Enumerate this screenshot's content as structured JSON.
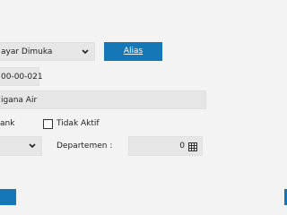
{
  "form": {
    "account_type": {
      "value": "ayar Dimuka"
    },
    "alias_button": {
      "label": "Alias"
    },
    "account_number": {
      "value": "00-00-021"
    },
    "account_name": {
      "value": "igana Air"
    },
    "bank_label": "ank",
    "inactive_checkbox": {
      "label": "Tidak Aktif",
      "checked": false
    },
    "department": {
      "label": "Departemen :",
      "value": "0"
    }
  },
  "colors": {
    "accent": "#1677b7",
    "field_bg": "#e6e6e6",
    "page_bg": "#f3f3f3"
  },
  "icons": {
    "dropdown": "chevron-down-icon",
    "lookup": "table-grid-icon"
  }
}
